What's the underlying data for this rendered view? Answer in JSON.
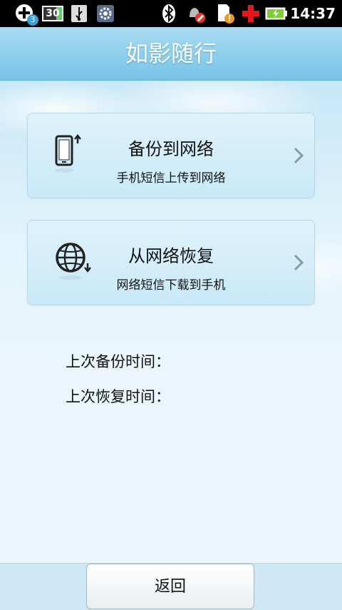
{
  "status_bar": {
    "time": "14:37",
    "badge_count": "3",
    "icons": [
      "add-icon",
      "battery-30-icon",
      "usb-icon",
      "settings-icon",
      "bluetooth-icon",
      "alarm-off-icon",
      "sd-warning-icon",
      "red-cross-icon",
      "battery-charging-icon"
    ],
    "battery_level_label": "30"
  },
  "header": {
    "title": "如影随行"
  },
  "cards": [
    {
      "main": "备份到网络",
      "sub": "手机短信上传到网络",
      "icon": "phone-upload-icon"
    },
    {
      "main": "从网络恢复",
      "sub": "网络短信下载到手机",
      "icon": "globe-download-icon"
    }
  ],
  "info": {
    "last_backup_label": "上次备份时间：",
    "last_restore_label": "上次恢复时间："
  },
  "footer": {
    "back_label": "返回"
  },
  "colors": {
    "title_bar": "#8fd0ee",
    "background": "#eaf6fc",
    "card": "#d4eef9"
  }
}
